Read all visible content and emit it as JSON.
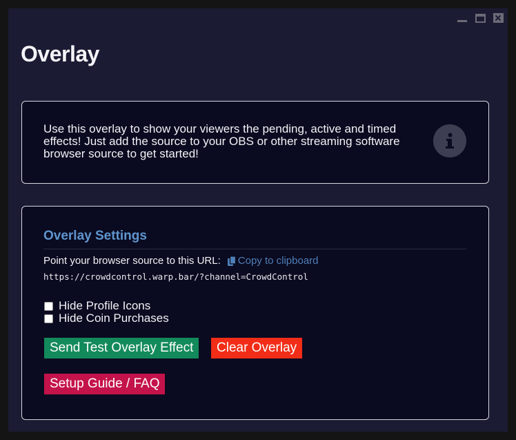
{
  "window": {
    "controls": [
      "minimize-icon",
      "maximize-icon",
      "close-icon"
    ]
  },
  "page": {
    "title": "Overlay"
  },
  "info": {
    "text": "Use this overlay to show your viewers the pending, active and timed effects! Just add the source to your OBS or other streaming software browser source to get started!",
    "icon": "info-icon"
  },
  "settings": {
    "title": "Overlay Settings",
    "url_label": "Point your browser source to this URL:",
    "copy_label": "Copy to clipboard",
    "url": "https://crowdcontrol.warp.bar/?channel=CrowdControl",
    "options": [
      {
        "label": "Hide Profile Icons",
        "checked": false
      },
      {
        "label": "Hide Coin Purchases",
        "checked": false
      }
    ],
    "buttons": {
      "test": "Send Test Overlay Effect",
      "clear": "Clear Overlay",
      "guide": "Setup Guide / FAQ"
    }
  },
  "colors": {
    "background": "#1b1b33",
    "card": "#0a0a20",
    "accent_blue": "#5f95ce",
    "green": "#138a5b",
    "red": "#f22d17",
    "crimson": "#c4134a"
  }
}
